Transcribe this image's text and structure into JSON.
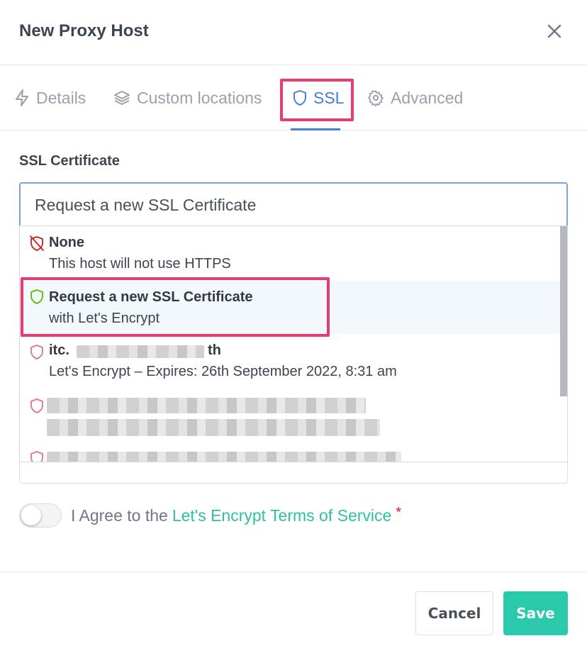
{
  "modal": {
    "title": "New Proxy Host"
  },
  "tabs": [
    {
      "label": "Details",
      "icon": "bolt-icon"
    },
    {
      "label": "Custom locations",
      "icon": "layers-icon"
    },
    {
      "label": "SSL",
      "icon": "shield-icon",
      "active": true
    },
    {
      "label": "Advanced",
      "icon": "gear-icon"
    }
  ],
  "ssl": {
    "field_label": "SSL Certificate",
    "selected_value": "Request a new SSL Certificate",
    "options": [
      {
        "title": "None",
        "subtitle": "This host will not use HTTPS",
        "icon": "shield-off-icon",
        "icon_color": "#cd201f"
      },
      {
        "title": "Request a new SSL Certificate",
        "subtitle": "with Let's Encrypt",
        "icon": "shield-icon",
        "icon_color": "#5eba00",
        "selected": true
      },
      {
        "title": "itc.",
        "title_suffix": "th",
        "subtitle": "Let's Encrypt – Expires: 26th September 2022, 8:31 am",
        "icon": "shield-icon",
        "icon_color": "#e5728f"
      },
      {
        "icon": "shield-icon",
        "icon_color": "#e5728f"
      },
      {
        "icon": "shield-icon",
        "icon_color": "#e5728f"
      }
    ]
  },
  "agree": {
    "prefix": "I Agree to the",
    "link": "Let's Encrypt Terms of Service",
    "required_mark": "*",
    "checked": false
  },
  "footer": {
    "cancel_label": "Cancel",
    "save_label": "Save"
  },
  "colors": {
    "accent": "#467fcf",
    "teal": "#2bc9ac",
    "highlight": "#ec3a6e"
  }
}
